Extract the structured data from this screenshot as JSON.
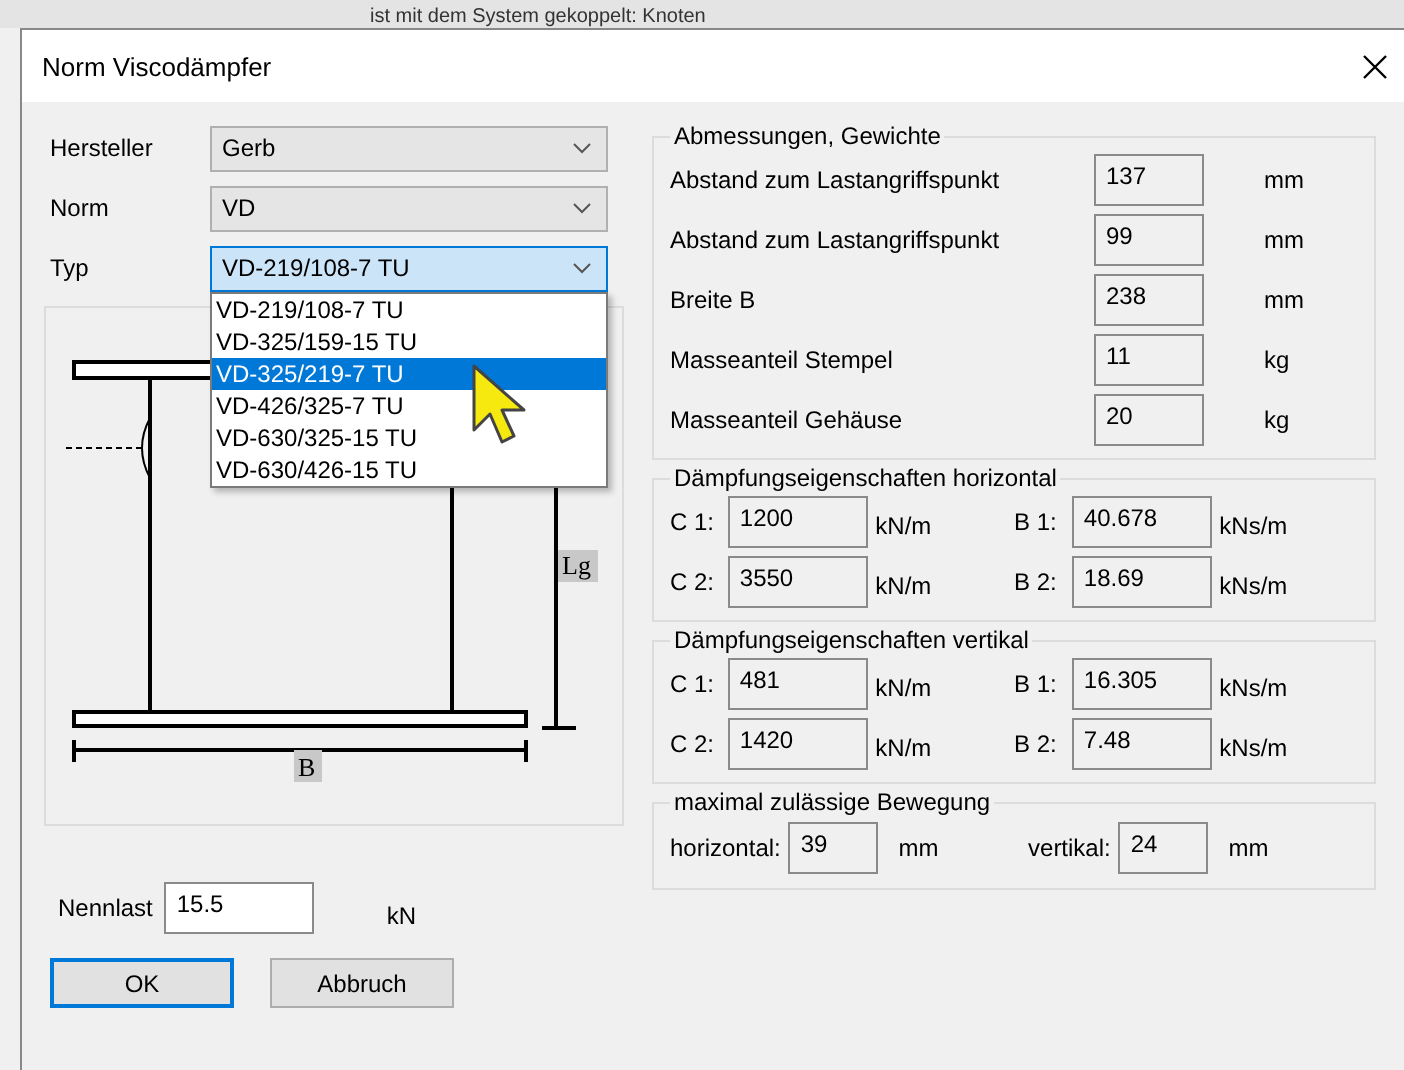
{
  "background_text": "ist mit dem System gekoppelt: Knoten",
  "window": {
    "title": "Norm Viscodämpfer"
  },
  "selectors": [
    {
      "label": "Hersteller",
      "value": "Gerb",
      "focused": false
    },
    {
      "label": "Norm",
      "value": "VD",
      "focused": false
    },
    {
      "label": "Typ",
      "value": "VD-219/108-7 TU",
      "focused": true
    }
  ],
  "type_dropdown": {
    "options": [
      {
        "label": "VD-219/108-7 TU",
        "selected": false
      },
      {
        "label": "VD-325/159-15 TU",
        "selected": false
      },
      {
        "label": "VD-325/219-7 TU",
        "selected": true
      },
      {
        "label": "VD-426/325-7 TU",
        "selected": false
      },
      {
        "label": "VD-630/325-15 TU",
        "selected": false
      },
      {
        "label": "VD-630/426-15 TU",
        "selected": false
      }
    ]
  },
  "drawing": {
    "height_label": "Lg",
    "width_label": "B"
  },
  "nennlast": {
    "label": "Nennlast",
    "value": "15.5",
    "unit": "kN"
  },
  "buttons": [
    {
      "label": "OK",
      "default": true
    },
    {
      "label": "Abbruch",
      "default": false
    }
  ],
  "dimensions": {
    "title": "Abmessungen, Gewichte",
    "rows": [
      {
        "label": "Abstand zum Lastangriffspunkt",
        "value": "137",
        "unit": "mm"
      },
      {
        "label": "Abstand zum Lastangriffspunkt",
        "value": "99",
        "unit": "mm"
      },
      {
        "label": "Breite B",
        "value": "238",
        "unit": "mm"
      },
      {
        "label": "Masseanteil Stempel",
        "value": "11",
        "unit": "kg"
      },
      {
        "label": "Masseanteil Gehäuse",
        "value": "20",
        "unit": "kg"
      }
    ]
  },
  "damping_groups": [
    {
      "title": "Dämpfungseigenschaften horizontal",
      "rows": [
        {
          "c_label": "C 1:",
          "c_value": "1200",
          "c_unit": "kN/m",
          "b_label": "B 1:",
          "b_value": "40.678",
          "b_unit": "kNs/m"
        },
        {
          "c_label": "C 2:",
          "c_value": "3550",
          "c_unit": "kN/m",
          "b_label": "B 2:",
          "b_value": "18.69",
          "b_unit": "kNs/m"
        }
      ]
    },
    {
      "title": "Dämpfungseigenschaften vertikal",
      "rows": [
        {
          "c_label": "C 1:",
          "c_value": "481",
          "c_unit": "kN/m",
          "b_label": "B 1:",
          "b_value": "16.305",
          "b_unit": "kNs/m"
        },
        {
          "c_label": "C 2:",
          "c_value": "1420",
          "c_unit": "kN/m",
          "b_label": "B 2:",
          "b_value": "7.48",
          "b_unit": "kNs/m"
        }
      ]
    }
  ],
  "movement": {
    "title": "maximal zulässige Bewegung",
    "items": [
      {
        "label": "horizontal:",
        "value": "39",
        "unit": "mm"
      },
      {
        "label": "vertikal:",
        "value": "24",
        "unit": "mm"
      }
    ]
  }
}
